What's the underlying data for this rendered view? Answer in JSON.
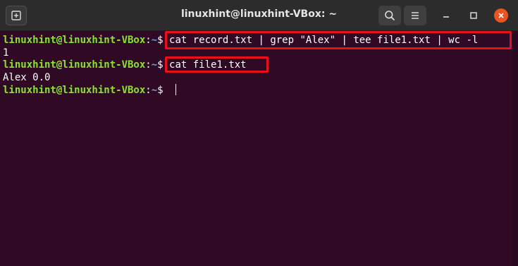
{
  "window": {
    "title": "linuxhint@linuxhint-VBox: ~"
  },
  "icons": {
    "new_tab": "new-tab-icon",
    "search": "search-icon",
    "menu": "hamburger-menu-icon",
    "minimize": "minimize-icon",
    "maximize": "maximize-icon",
    "close": "close-icon"
  },
  "colors": {
    "background": "#300a24",
    "prompt_user": "#8ae234",
    "prompt_path": "#729fcf",
    "highlight": "#e8101a",
    "close_button": "#e95420"
  },
  "terminal": {
    "prompt_user": "linuxhint@linuxhint-VBox",
    "prompt_colon": ":",
    "prompt_path": "~",
    "prompt_dollar": "$ ",
    "lines": [
      {
        "type": "command",
        "command": "cat record.txt | grep \"Alex\" | tee file1.txt | wc -l"
      },
      {
        "type": "output",
        "text": "1"
      },
      {
        "type": "command",
        "command": "cat file1.txt"
      },
      {
        "type": "output",
        "text": "Alex 0.0"
      },
      {
        "type": "prompt",
        "command": ""
      }
    ]
  }
}
